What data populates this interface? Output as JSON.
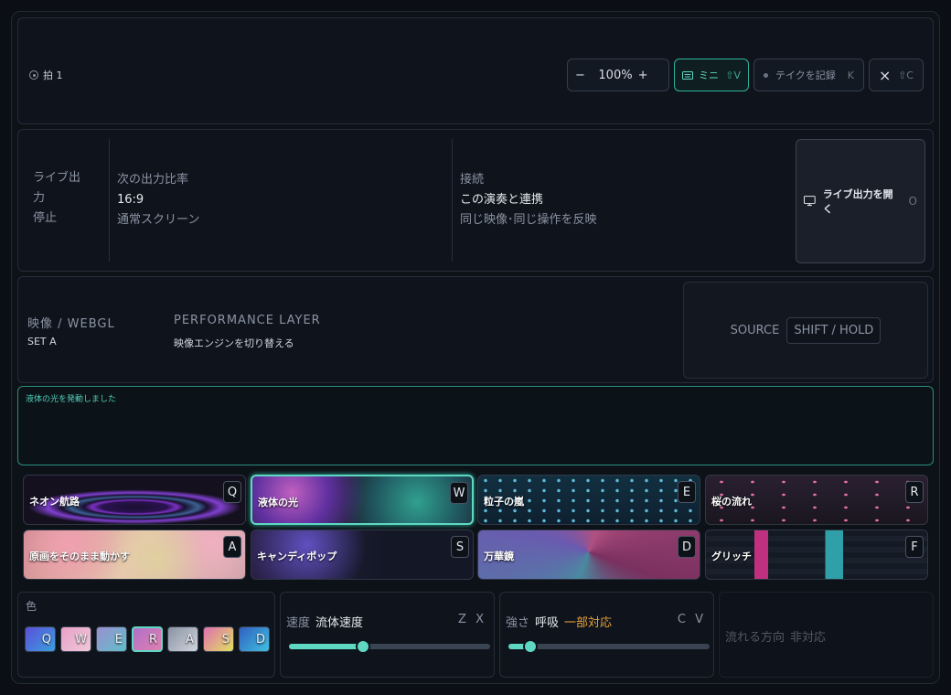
{
  "topbar": {
    "beat_label": "拍 1",
    "zoom": {
      "minus": "−",
      "value": "100%",
      "plus": "+"
    },
    "mini": {
      "label": "ミニ",
      "key": "⇧V"
    },
    "record": {
      "label": "テイクを記録",
      "key": "K"
    },
    "close": {
      "icon": "×",
      "key": "⇧C"
    }
  },
  "live": {
    "label": "ライブ出力",
    "state": "停止",
    "ratio": {
      "heading": "次の出力比率",
      "value": "16:9",
      "note": "通常スクリーン"
    },
    "connect": {
      "heading": "接続",
      "value": "この演奏と連携",
      "note": "同じ映像･同じ操作を反映"
    },
    "open_button": {
      "label": "ライブ出力を開く",
      "key": "O"
    }
  },
  "performance": {
    "title1": "映像 / WEBGL",
    "sub1": "SET A",
    "title2": "PERFORMANCE LAYER",
    "sub2": "映像エンジンを切り替える",
    "source_label": "SOURCE",
    "source_chip": "SHIFT / HOLD"
  },
  "toast": {
    "message": "液体の光を発動しました"
  },
  "presets": [
    {
      "label": "ネオン航路",
      "key": "Q",
      "active": false
    },
    {
      "label": "液体の光",
      "key": "W",
      "active": true
    },
    {
      "label": "粒子の嵐",
      "key": "E",
      "active": false
    },
    {
      "label": "桜の流れ",
      "key": "R",
      "active": false
    },
    {
      "label": "原画をそのまま動かす",
      "key": "A",
      "active": false
    },
    {
      "label": "キャンディポップ",
      "key": "S",
      "active": false
    },
    {
      "label": "万華鏡",
      "key": "D",
      "active": false
    },
    {
      "label": "グリッチ",
      "key": "F",
      "active": false
    }
  ],
  "colors": {
    "label": "色",
    "swatches": [
      {
        "key": "Q",
        "colors": [
          "#5b4fd8",
          "#3aa0e0"
        ]
      },
      {
        "key": "W",
        "colors": [
          "#e8a0c8",
          "#f0c8d8"
        ]
      },
      {
        "key": "E",
        "colors": [
          "#9a8fd0",
          "#60c0c8"
        ]
      },
      {
        "key": "R",
        "colors": [
          "#b070c8",
          "#e080b0"
        ],
        "active": true
      },
      {
        "key": "A",
        "colors": [
          "#8a93a3",
          "#d0d5dd"
        ]
      },
      {
        "key": "S",
        "colors": [
          "#e070b0",
          "#e0e060"
        ]
      },
      {
        "key": "D",
        "colors": [
          "#3060c0",
          "#40c0e0"
        ]
      }
    ]
  },
  "speed": {
    "label": "速度",
    "value": "流体速度",
    "keys": "Z X",
    "level": 0.37
  },
  "strength": {
    "label": "強さ",
    "value": "呼吸",
    "badge": "一部対応",
    "keys": "C V",
    "level": 0.11
  },
  "direction": {
    "label": "流れる方向",
    "value": "非対応"
  },
  "accent": "#5fd8c3"
}
